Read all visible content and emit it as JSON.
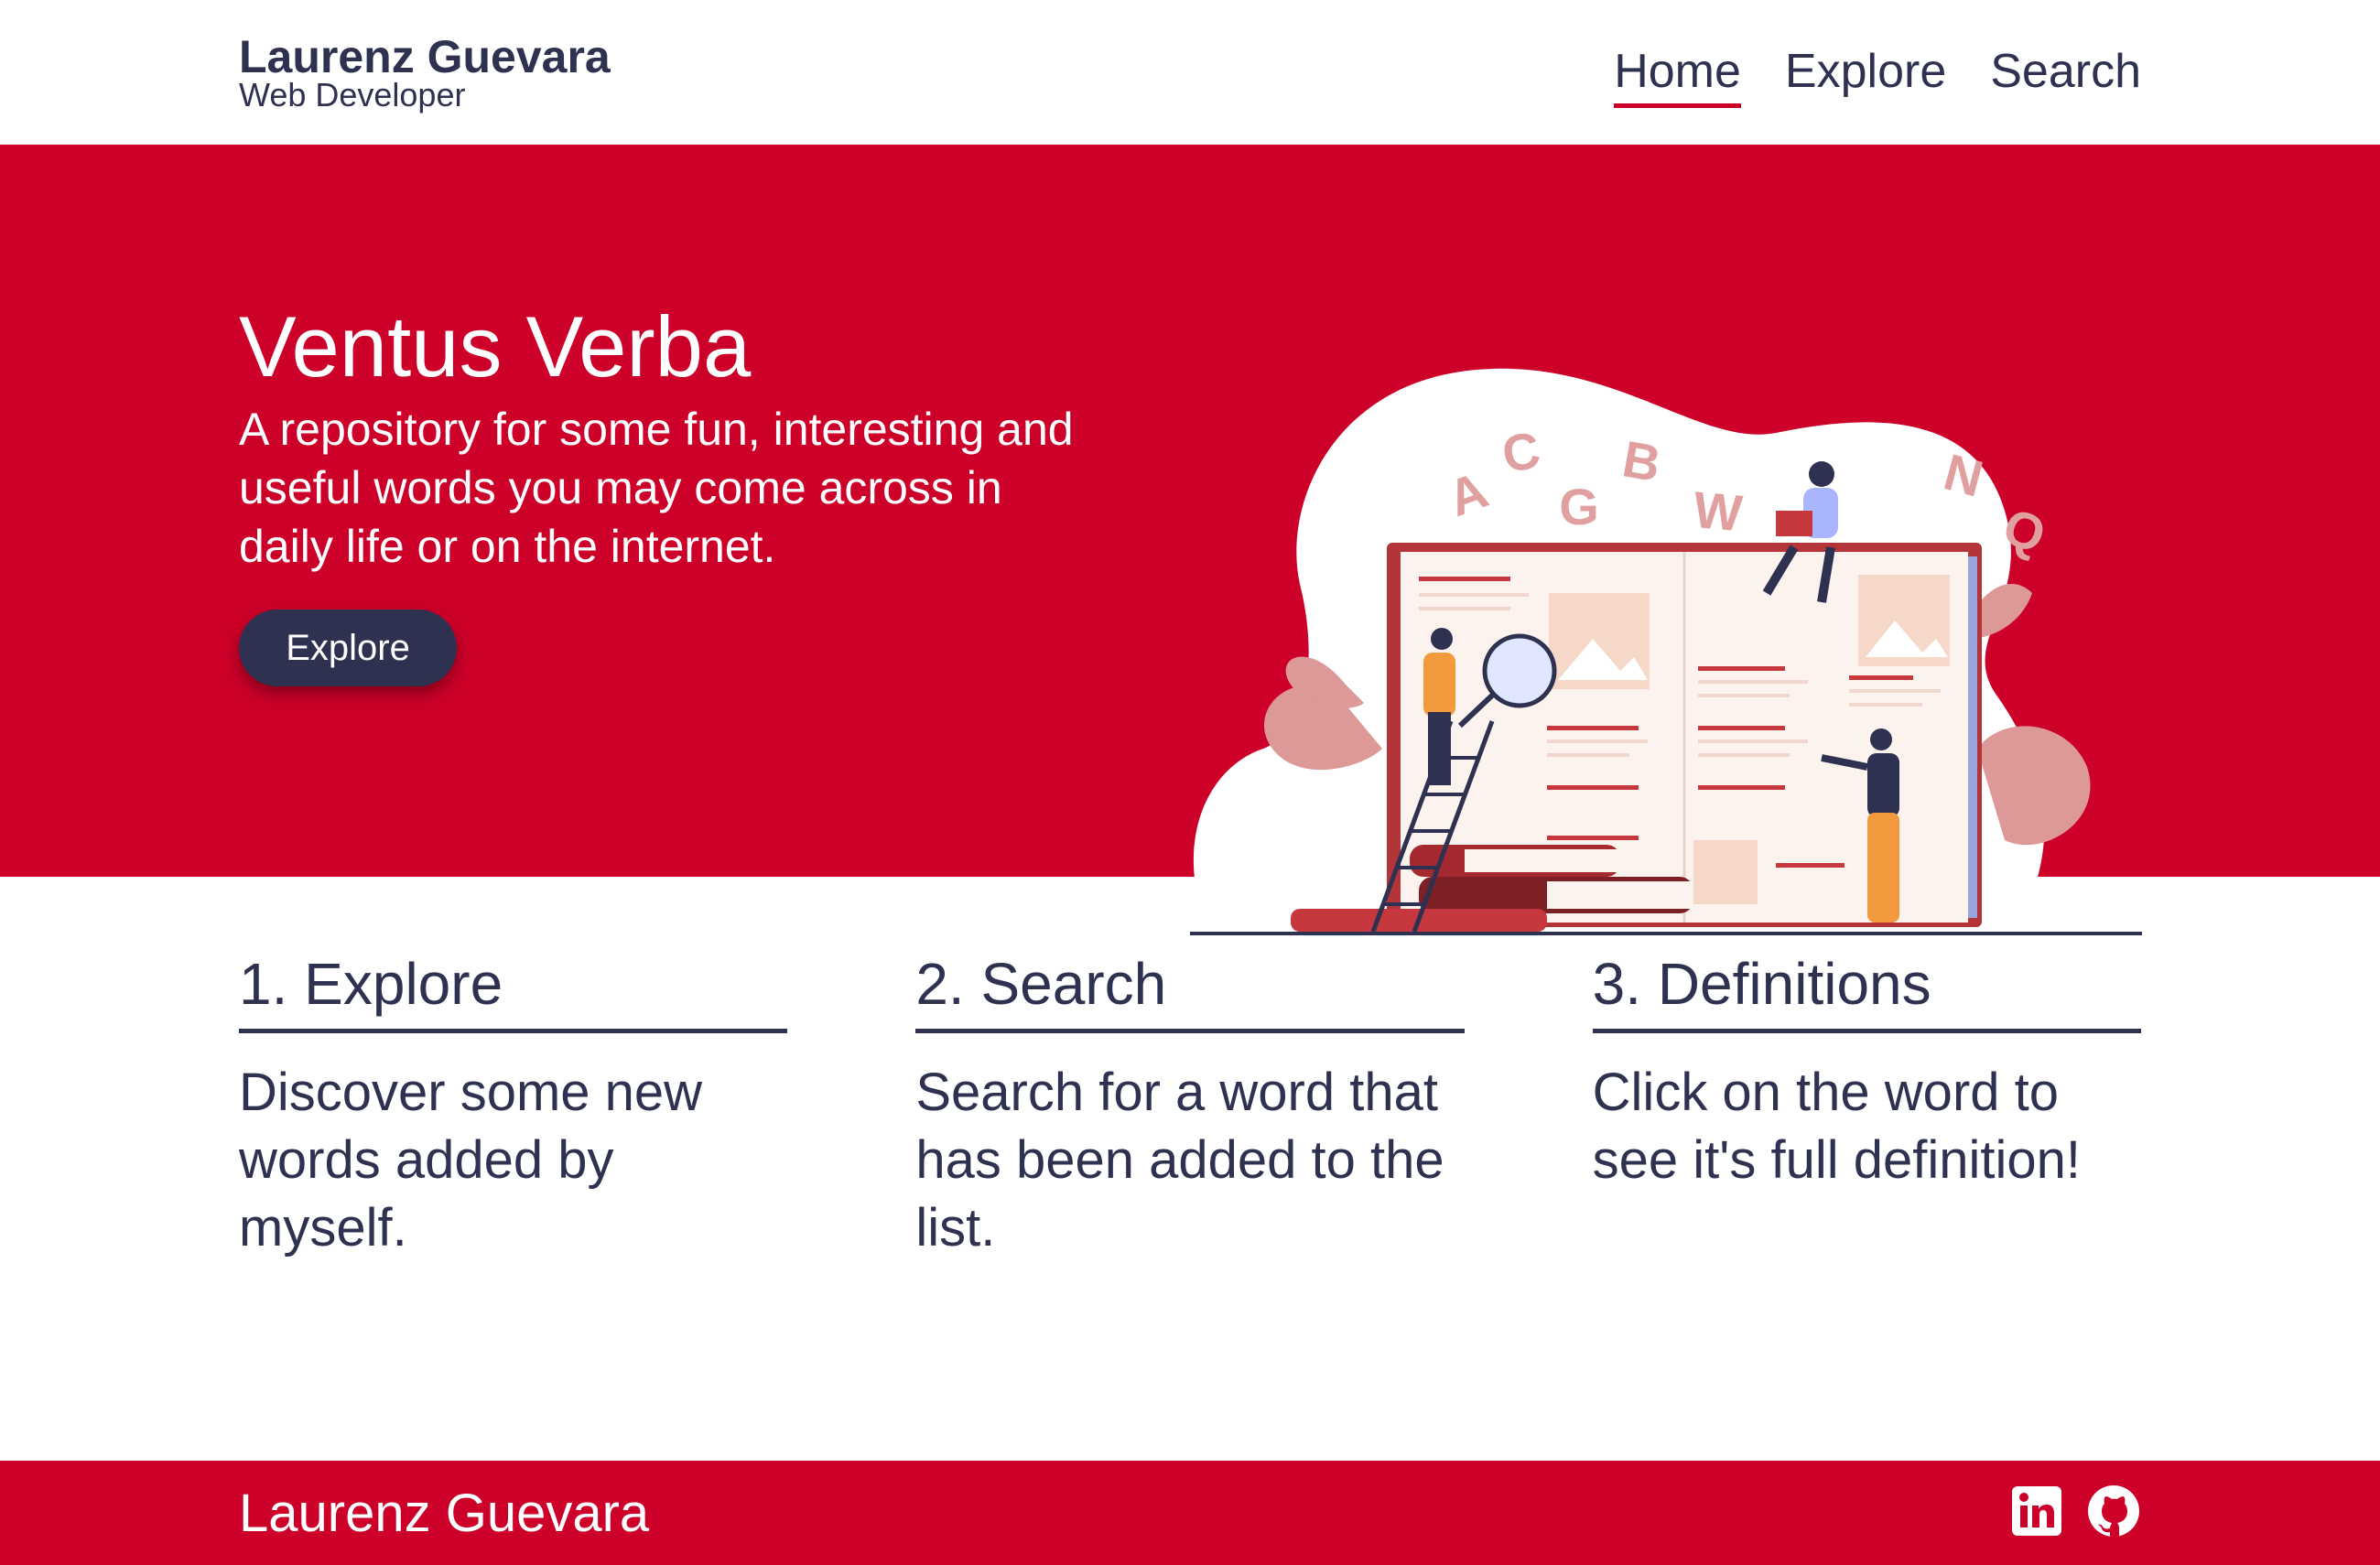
{
  "header": {
    "name": "Laurenz Guevara",
    "subtitle": "Web Developer",
    "nav": [
      "Home",
      "Explore",
      "Search"
    ]
  },
  "hero": {
    "title": "Ventus Verba",
    "description": "A repository for some fun, interesting and useful words you may come across in daily life or on the internet.",
    "button": "Explore",
    "illustration_letters": [
      "A",
      "C",
      "G",
      "B",
      "W",
      "N",
      "Q"
    ]
  },
  "features": [
    {
      "title": "1. Explore",
      "text": "Discover some new words added by myself."
    },
    {
      "title": "2. Search",
      "text": "Search for a word that has been added to the list."
    },
    {
      "title": "3. Definitions",
      "text": "Click on the word to see it's full definition!"
    }
  ],
  "footer": {
    "name": "Laurenz Guevara",
    "icons": [
      "linkedin-icon",
      "github-icon"
    ]
  },
  "colors": {
    "accent": "#cc0029",
    "dark": "#2e3250",
    "white": "#ffffff"
  }
}
